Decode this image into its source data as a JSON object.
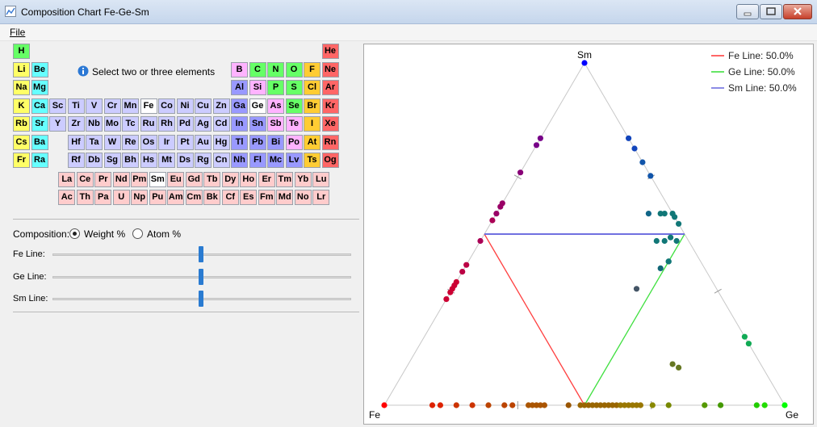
{
  "window": {
    "title": "Composition Chart Fe-Ge-Sm"
  },
  "menu": {
    "file": "File"
  },
  "hint": "Select two or three elements",
  "colors": {
    "alkali": "#ffff66",
    "alkaline": "#66ffff",
    "transition": "#ccccff",
    "post": "#9999ff",
    "metalloid": "#ffb3ff",
    "nonmetal": "#66ff66",
    "halogen": "#ffcc33",
    "noble": "#ff6666",
    "lanthanide": "#ffcccc",
    "selected": "#ffffff"
  },
  "periodic_table": [
    {
      "s": "H",
      "r": 0,
      "c": 0,
      "k": "nonmetal"
    },
    {
      "s": "He",
      "r": 0,
      "c": 17,
      "k": "noble"
    },
    {
      "s": "Li",
      "r": 1,
      "c": 0,
      "k": "alkali"
    },
    {
      "s": "Be",
      "r": 1,
      "c": 1,
      "k": "alkaline"
    },
    {
      "s": "B",
      "r": 1,
      "c": 12,
      "k": "metalloid"
    },
    {
      "s": "C",
      "r": 1,
      "c": 13,
      "k": "nonmetal"
    },
    {
      "s": "N",
      "r": 1,
      "c": 14,
      "k": "nonmetal"
    },
    {
      "s": "O",
      "r": 1,
      "c": 15,
      "k": "nonmetal"
    },
    {
      "s": "F",
      "r": 1,
      "c": 16,
      "k": "halogen"
    },
    {
      "s": "Ne",
      "r": 1,
      "c": 17,
      "k": "noble"
    },
    {
      "s": "Na",
      "r": 2,
      "c": 0,
      "k": "alkali"
    },
    {
      "s": "Mg",
      "r": 2,
      "c": 1,
      "k": "alkaline"
    },
    {
      "s": "Al",
      "r": 2,
      "c": 12,
      "k": "post"
    },
    {
      "s": "Si",
      "r": 2,
      "c": 13,
      "k": "metalloid"
    },
    {
      "s": "P",
      "r": 2,
      "c": 14,
      "k": "nonmetal"
    },
    {
      "s": "S",
      "r": 2,
      "c": 15,
      "k": "nonmetal"
    },
    {
      "s": "Cl",
      "r": 2,
      "c": 16,
      "k": "halogen"
    },
    {
      "s": "Ar",
      "r": 2,
      "c": 17,
      "k": "noble"
    },
    {
      "s": "K",
      "r": 3,
      "c": 0,
      "k": "alkali"
    },
    {
      "s": "Ca",
      "r": 3,
      "c": 1,
      "k": "alkaline"
    },
    {
      "s": "Sc",
      "r": 3,
      "c": 2,
      "k": "transition"
    },
    {
      "s": "Ti",
      "r": 3,
      "c": 3,
      "k": "transition"
    },
    {
      "s": "V",
      "r": 3,
      "c": 4,
      "k": "transition"
    },
    {
      "s": "Cr",
      "r": 3,
      "c": 5,
      "k": "transition"
    },
    {
      "s": "Mn",
      "r": 3,
      "c": 6,
      "k": "transition"
    },
    {
      "s": "Fe",
      "r": 3,
      "c": 7,
      "k": "selected"
    },
    {
      "s": "Co",
      "r": 3,
      "c": 8,
      "k": "transition"
    },
    {
      "s": "Ni",
      "r": 3,
      "c": 9,
      "k": "transition"
    },
    {
      "s": "Cu",
      "r": 3,
      "c": 10,
      "k": "transition"
    },
    {
      "s": "Zn",
      "r": 3,
      "c": 11,
      "k": "transition"
    },
    {
      "s": "Ga",
      "r": 3,
      "c": 12,
      "k": "post"
    },
    {
      "s": "Ge",
      "r": 3,
      "c": 13,
      "k": "selected"
    },
    {
      "s": "As",
      "r": 3,
      "c": 14,
      "k": "metalloid"
    },
    {
      "s": "Se",
      "r": 3,
      "c": 15,
      "k": "nonmetal"
    },
    {
      "s": "Br",
      "r": 3,
      "c": 16,
      "k": "halogen"
    },
    {
      "s": "Kr",
      "r": 3,
      "c": 17,
      "k": "noble"
    },
    {
      "s": "Rb",
      "r": 4,
      "c": 0,
      "k": "alkali"
    },
    {
      "s": "Sr",
      "r": 4,
      "c": 1,
      "k": "alkaline"
    },
    {
      "s": "Y",
      "r": 4,
      "c": 2,
      "k": "transition"
    },
    {
      "s": "Zr",
      "r": 4,
      "c": 3,
      "k": "transition"
    },
    {
      "s": "Nb",
      "r": 4,
      "c": 4,
      "k": "transition"
    },
    {
      "s": "Mo",
      "r": 4,
      "c": 5,
      "k": "transition"
    },
    {
      "s": "Tc",
      "r": 4,
      "c": 6,
      "k": "transition"
    },
    {
      "s": "Ru",
      "r": 4,
      "c": 7,
      "k": "transition"
    },
    {
      "s": "Rh",
      "r": 4,
      "c": 8,
      "k": "transition"
    },
    {
      "s": "Pd",
      "r": 4,
      "c": 9,
      "k": "transition"
    },
    {
      "s": "Ag",
      "r": 4,
      "c": 10,
      "k": "transition"
    },
    {
      "s": "Cd",
      "r": 4,
      "c": 11,
      "k": "transition"
    },
    {
      "s": "In",
      "r": 4,
      "c": 12,
      "k": "post"
    },
    {
      "s": "Sn",
      "r": 4,
      "c": 13,
      "k": "post"
    },
    {
      "s": "Sb",
      "r": 4,
      "c": 14,
      "k": "metalloid"
    },
    {
      "s": "Te",
      "r": 4,
      "c": 15,
      "k": "metalloid"
    },
    {
      "s": "I",
      "r": 4,
      "c": 16,
      "k": "halogen"
    },
    {
      "s": "Xe",
      "r": 4,
      "c": 17,
      "k": "noble"
    },
    {
      "s": "Cs",
      "r": 5,
      "c": 0,
      "k": "alkali"
    },
    {
      "s": "Ba",
      "r": 5,
      "c": 1,
      "k": "alkaline"
    },
    {
      "s": "Hf",
      "r": 5,
      "c": 3,
      "k": "transition"
    },
    {
      "s": "Ta",
      "r": 5,
      "c": 4,
      "k": "transition"
    },
    {
      "s": "W",
      "r": 5,
      "c": 5,
      "k": "transition"
    },
    {
      "s": "Re",
      "r": 5,
      "c": 6,
      "k": "transition"
    },
    {
      "s": "Os",
      "r": 5,
      "c": 7,
      "k": "transition"
    },
    {
      "s": "Ir",
      "r": 5,
      "c": 8,
      "k": "transition"
    },
    {
      "s": "Pt",
      "r": 5,
      "c": 9,
      "k": "transition"
    },
    {
      "s": "Au",
      "r": 5,
      "c": 10,
      "k": "transition"
    },
    {
      "s": "Hg",
      "r": 5,
      "c": 11,
      "k": "transition"
    },
    {
      "s": "Tl",
      "r": 5,
      "c": 12,
      "k": "post"
    },
    {
      "s": "Pb",
      "r": 5,
      "c": 13,
      "k": "post"
    },
    {
      "s": "Bi",
      "r": 5,
      "c": 14,
      "k": "post"
    },
    {
      "s": "Po",
      "r": 5,
      "c": 15,
      "k": "metalloid"
    },
    {
      "s": "At",
      "r": 5,
      "c": 16,
      "k": "halogen"
    },
    {
      "s": "Rn",
      "r": 5,
      "c": 17,
      "k": "noble"
    },
    {
      "s": "Fr",
      "r": 6,
      "c": 0,
      "k": "alkali"
    },
    {
      "s": "Ra",
      "r": 6,
      "c": 1,
      "k": "alkaline"
    },
    {
      "s": "Rf",
      "r": 6,
      "c": 3,
      "k": "transition"
    },
    {
      "s": "Db",
      "r": 6,
      "c": 4,
      "k": "transition"
    },
    {
      "s": "Sg",
      "r": 6,
      "c": 5,
      "k": "transition"
    },
    {
      "s": "Bh",
      "r": 6,
      "c": 6,
      "k": "transition"
    },
    {
      "s": "Hs",
      "r": 6,
      "c": 7,
      "k": "transition"
    },
    {
      "s": "Mt",
      "r": 6,
      "c": 8,
      "k": "transition"
    },
    {
      "s": "Ds",
      "r": 6,
      "c": 9,
      "k": "transition"
    },
    {
      "s": "Rg",
      "r": 6,
      "c": 10,
      "k": "transition"
    },
    {
      "s": "Cn",
      "r": 6,
      "c": 11,
      "k": "transition"
    },
    {
      "s": "Nh",
      "r": 6,
      "c": 12,
      "k": "post"
    },
    {
      "s": "Fl",
      "r": 6,
      "c": 13,
      "k": "post"
    },
    {
      "s": "Mc",
      "r": 6,
      "c": 14,
      "k": "post"
    },
    {
      "s": "Lv",
      "r": 6,
      "c": 15,
      "k": "post"
    },
    {
      "s": "Ts",
      "r": 6,
      "c": 16,
      "k": "halogen"
    },
    {
      "s": "Og",
      "r": 6,
      "c": 17,
      "k": "noble"
    },
    {
      "s": "La",
      "r": 7,
      "c": 2.5,
      "k": "lanthanide"
    },
    {
      "s": "Ce",
      "r": 7,
      "c": 3.5,
      "k": "lanthanide"
    },
    {
      "s": "Pr",
      "r": 7,
      "c": 4.5,
      "k": "lanthanide"
    },
    {
      "s": "Nd",
      "r": 7,
      "c": 5.5,
      "k": "lanthanide"
    },
    {
      "s": "Pm",
      "r": 7,
      "c": 6.5,
      "k": "lanthanide"
    },
    {
      "s": "Sm",
      "r": 7,
      "c": 7.5,
      "k": "selected"
    },
    {
      "s": "Eu",
      "r": 7,
      "c": 8.5,
      "k": "lanthanide"
    },
    {
      "s": "Gd",
      "r": 7,
      "c": 9.5,
      "k": "lanthanide"
    },
    {
      "s": "Tb",
      "r": 7,
      "c": 10.5,
      "k": "lanthanide"
    },
    {
      "s": "Dy",
      "r": 7,
      "c": 11.5,
      "k": "lanthanide"
    },
    {
      "s": "Ho",
      "r": 7,
      "c": 12.5,
      "k": "lanthanide"
    },
    {
      "s": "Er",
      "r": 7,
      "c": 13.5,
      "k": "lanthanide"
    },
    {
      "s": "Tm",
      "r": 7,
      "c": 14.5,
      "k": "lanthanide"
    },
    {
      "s": "Yb",
      "r": 7,
      "c": 15.5,
      "k": "lanthanide"
    },
    {
      "s": "Lu",
      "r": 7,
      "c": 16.5,
      "k": "lanthanide"
    },
    {
      "s": "Ac",
      "r": 8,
      "c": 2.5,
      "k": "lanthanide"
    },
    {
      "s": "Th",
      "r": 8,
      "c": 3.5,
      "k": "lanthanide"
    },
    {
      "s": "Pa",
      "r": 8,
      "c": 4.5,
      "k": "lanthanide"
    },
    {
      "s": "U",
      "r": 8,
      "c": 5.5,
      "k": "lanthanide"
    },
    {
      "s": "Np",
      "r": 8,
      "c": 6.5,
      "k": "lanthanide"
    },
    {
      "s": "Pu",
      "r": 8,
      "c": 7.5,
      "k": "lanthanide"
    },
    {
      "s": "Am",
      "r": 8,
      "c": 8.5,
      "k": "lanthanide"
    },
    {
      "s": "Cm",
      "r": 8,
      "c": 9.5,
      "k": "lanthanide"
    },
    {
      "s": "Bk",
      "r": 8,
      "c": 10.5,
      "k": "lanthanide"
    },
    {
      "s": "Cf",
      "r": 8,
      "c": 11.5,
      "k": "lanthanide"
    },
    {
      "s": "Es",
      "r": 8,
      "c": 12.5,
      "k": "lanthanide"
    },
    {
      "s": "Fm",
      "r": 8,
      "c": 13.5,
      "k": "lanthanide"
    },
    {
      "s": "Md",
      "r": 8,
      "c": 14.5,
      "k": "lanthanide"
    },
    {
      "s": "No",
      "r": 8,
      "c": 15.5,
      "k": "lanthanide"
    },
    {
      "s": "Lr",
      "r": 8,
      "c": 16.5,
      "k": "lanthanide"
    }
  ],
  "composition": {
    "label": "Composition:",
    "options": [
      "Weight %",
      "Atom %"
    ],
    "selected": "Weight %"
  },
  "sliders": [
    {
      "label": "Fe Line:",
      "value": 0.5
    },
    {
      "label": "Ge Line:",
      "value": 0.5
    },
    {
      "label": "Sm Line:",
      "value": 0.5
    }
  ],
  "chart_data": {
    "type": "scatter",
    "subtype": "ternary",
    "corners": {
      "left": "Fe",
      "right": "Ge",
      "top": "Sm"
    },
    "series": [
      {
        "name": "Fe Line: 50.0%",
        "color": "#ff4040",
        "value": 50.0
      },
      {
        "name": "Ge Line: 50.0%",
        "color": "#40e040",
        "value": 50.0
      },
      {
        "name": "Sm Line: 50.0%",
        "color": "#7070e0",
        "value": 50.0
      }
    ],
    "points": [
      {
        "fe": 1.0,
        "ge": 0.0,
        "sm": 0.0,
        "color": "#ff0000"
      },
      {
        "fe": 0.88,
        "ge": 0.12,
        "sm": 0.0,
        "color": "#dd2200"
      },
      {
        "fe": 0.86,
        "ge": 0.14,
        "sm": 0.0,
        "color": "#dd2200"
      },
      {
        "fe": 0.82,
        "ge": 0.18,
        "sm": 0.0,
        "color": "#cc3300"
      },
      {
        "fe": 0.78,
        "ge": 0.22,
        "sm": 0.0,
        "color": "#cc3300"
      },
      {
        "fe": 0.74,
        "ge": 0.26,
        "sm": 0.0,
        "color": "#bb4400"
      },
      {
        "fe": 0.7,
        "ge": 0.3,
        "sm": 0.0,
        "color": "#bb4400"
      },
      {
        "fe": 0.68,
        "ge": 0.32,
        "sm": 0.0,
        "color": "#bb4400"
      },
      {
        "fe": 0.64,
        "ge": 0.36,
        "sm": 0.0,
        "color": "#aa5500"
      },
      {
        "fe": 0.63,
        "ge": 0.37,
        "sm": 0.0,
        "color": "#aa5500"
      },
      {
        "fe": 0.62,
        "ge": 0.38,
        "sm": 0.0,
        "color": "#aa5500"
      },
      {
        "fe": 0.61,
        "ge": 0.39,
        "sm": 0.0,
        "color": "#aa5500"
      },
      {
        "fe": 0.6,
        "ge": 0.4,
        "sm": 0.0,
        "color": "#aa5500"
      },
      {
        "fe": 0.54,
        "ge": 0.46,
        "sm": 0.0,
        "color": "#995500"
      },
      {
        "fe": 0.51,
        "ge": 0.49,
        "sm": 0.0,
        "color": "#996600"
      },
      {
        "fe": 0.5,
        "ge": 0.5,
        "sm": 0.0,
        "color": "#996600"
      },
      {
        "fe": 0.49,
        "ge": 0.51,
        "sm": 0.0,
        "color": "#996600"
      },
      {
        "fe": 0.48,
        "ge": 0.52,
        "sm": 0.0,
        "color": "#996600"
      },
      {
        "fe": 0.47,
        "ge": 0.53,
        "sm": 0.0,
        "color": "#996600"
      },
      {
        "fe": 0.46,
        "ge": 0.54,
        "sm": 0.0,
        "color": "#996600"
      },
      {
        "fe": 0.45,
        "ge": 0.55,
        "sm": 0.0,
        "color": "#996600"
      },
      {
        "fe": 0.44,
        "ge": 0.56,
        "sm": 0.0,
        "color": "#996600"
      },
      {
        "fe": 0.43,
        "ge": 0.57,
        "sm": 0.0,
        "color": "#996600"
      },
      {
        "fe": 0.42,
        "ge": 0.58,
        "sm": 0.0,
        "color": "#996600"
      },
      {
        "fe": 0.41,
        "ge": 0.59,
        "sm": 0.0,
        "color": "#997700"
      },
      {
        "fe": 0.4,
        "ge": 0.6,
        "sm": 0.0,
        "color": "#997700"
      },
      {
        "fe": 0.39,
        "ge": 0.61,
        "sm": 0.0,
        "color": "#997700"
      },
      {
        "fe": 0.38,
        "ge": 0.62,
        "sm": 0.0,
        "color": "#997700"
      },
      {
        "fe": 0.37,
        "ge": 0.63,
        "sm": 0.0,
        "color": "#997700"
      },
      {
        "fe": 0.36,
        "ge": 0.64,
        "sm": 0.0,
        "color": "#997700"
      },
      {
        "fe": 0.33,
        "ge": 0.67,
        "sm": 0.0,
        "color": "#888800"
      },
      {
        "fe": 0.29,
        "ge": 0.71,
        "sm": 0.0,
        "color": "#778800"
      },
      {
        "fe": 0.2,
        "ge": 0.8,
        "sm": 0.0,
        "color": "#559900"
      },
      {
        "fe": 0.16,
        "ge": 0.84,
        "sm": 0.0,
        "color": "#449900"
      },
      {
        "fe": 0.07,
        "ge": 0.93,
        "sm": 0.0,
        "color": "#22cc00"
      },
      {
        "fe": 0.05,
        "ge": 0.95,
        "sm": 0.0,
        "color": "#22dd00"
      },
      {
        "fe": 0.0,
        "ge": 1.0,
        "sm": 0.0,
        "color": "#00ff00"
      },
      {
        "fe": 0.69,
        "ge": 0.0,
        "sm": 0.31,
        "color": "#cc0033"
      },
      {
        "fe": 0.67,
        "ge": 0.0,
        "sm": 0.33,
        "color": "#cc0033"
      },
      {
        "fe": 0.66,
        "ge": 0.0,
        "sm": 0.34,
        "color": "#cc0033"
      },
      {
        "fe": 0.65,
        "ge": 0.0,
        "sm": 0.35,
        "color": "#cc0033"
      },
      {
        "fe": 0.64,
        "ge": 0.0,
        "sm": 0.36,
        "color": "#cc0033"
      },
      {
        "fe": 0.61,
        "ge": 0.0,
        "sm": 0.39,
        "color": "#bb0044"
      },
      {
        "fe": 0.59,
        "ge": 0.0,
        "sm": 0.41,
        "color": "#bb0044"
      },
      {
        "fe": 0.52,
        "ge": 0.0,
        "sm": 0.48,
        "color": "#aa0055"
      },
      {
        "fe": 0.46,
        "ge": 0.0,
        "sm": 0.54,
        "color": "#aa0055"
      },
      {
        "fe": 0.44,
        "ge": 0.0,
        "sm": 0.56,
        "color": "#990066"
      },
      {
        "fe": 0.42,
        "ge": 0.0,
        "sm": 0.58,
        "color": "#990066"
      },
      {
        "fe": 0.41,
        "ge": 0.0,
        "sm": 0.59,
        "color": "#990066"
      },
      {
        "fe": 0.32,
        "ge": 0.0,
        "sm": 0.68,
        "color": "#880077"
      },
      {
        "fe": 0.24,
        "ge": 0.0,
        "sm": 0.76,
        "color": "#770088"
      },
      {
        "fe": 0.22,
        "ge": 0.0,
        "sm": 0.78,
        "color": "#770088"
      },
      {
        "fe": 0.0,
        "ge": 0.0,
        "sm": 1.0,
        "color": "#0000ff"
      },
      {
        "fe": 0.0,
        "ge": 0.22,
        "sm": 0.78,
        "color": "#1144bb"
      },
      {
        "fe": 0.0,
        "ge": 0.25,
        "sm": 0.75,
        "color": "#1144bb"
      },
      {
        "fe": 0.0,
        "ge": 0.29,
        "sm": 0.71,
        "color": "#1155aa"
      },
      {
        "fe": 0.0,
        "ge": 0.33,
        "sm": 0.67,
        "color": "#1155aa"
      },
      {
        "fe": 0.0,
        "ge": 0.8,
        "sm": 0.2,
        "color": "#11aa55"
      },
      {
        "fe": 0.0,
        "ge": 0.82,
        "sm": 0.18,
        "color": "#11aa55"
      },
      {
        "fe": 0.06,
        "ge": 0.38,
        "sm": 0.56,
        "color": "#116688"
      },
      {
        "fe": 0.03,
        "ge": 0.41,
        "sm": 0.56,
        "color": "#117777"
      },
      {
        "fe": 0.0,
        "ge": 0.44,
        "sm": 0.56,
        "color": "#117777"
      },
      {
        "fe": 0.02,
        "ge": 0.42,
        "sm": 0.56,
        "color": "#117777"
      },
      {
        "fe": 0.0,
        "ge": 0.45,
        "sm": 0.55,
        "color": "#117777"
      },
      {
        "fe": 0.0,
        "ge": 0.47,
        "sm": 0.53,
        "color": "#117777"
      },
      {
        "fe": 0.06,
        "ge": 0.46,
        "sm": 0.48,
        "color": "#117777"
      },
      {
        "fe": 0.08,
        "ge": 0.44,
        "sm": 0.48,
        "color": "#117777"
      },
      {
        "fe": 0.04,
        "ge": 0.47,
        "sm": 0.49,
        "color": "#117777"
      },
      {
        "fe": 0.03,
        "ge": 0.49,
        "sm": 0.48,
        "color": "#117777"
      },
      {
        "fe": 0.08,
        "ge": 0.5,
        "sm": 0.42,
        "color": "#117777"
      },
      {
        "fe": 0.08,
        "ge": 0.5,
        "sm": 0.42,
        "color": "#117777"
      },
      {
        "fe": 0.11,
        "ge": 0.49,
        "sm": 0.4,
        "color": "#116677"
      },
      {
        "fe": 0.2,
        "ge": 0.46,
        "sm": 0.34,
        "color": "#445566"
      },
      {
        "fe": 0.22,
        "ge": 0.66,
        "sm": 0.12,
        "color": "#667722"
      },
      {
        "fe": 0.21,
        "ge": 0.68,
        "sm": 0.11,
        "color": "#667722"
      }
    ]
  }
}
